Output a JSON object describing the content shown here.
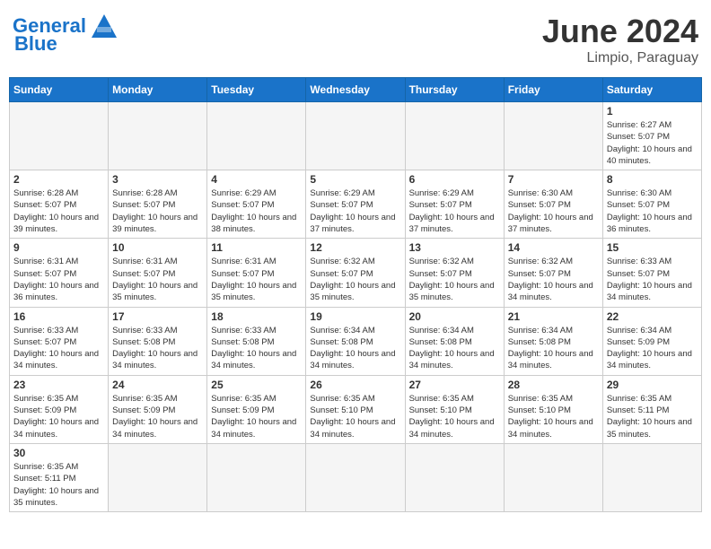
{
  "header": {
    "logo_general": "General",
    "logo_blue": "Blue",
    "title": "June 2024",
    "location": "Limpio, Paraguay"
  },
  "days_of_week": [
    "Sunday",
    "Monday",
    "Tuesday",
    "Wednesday",
    "Thursday",
    "Friday",
    "Saturday"
  ],
  "weeks": [
    [
      {
        "day": "",
        "info": ""
      },
      {
        "day": "",
        "info": ""
      },
      {
        "day": "",
        "info": ""
      },
      {
        "day": "",
        "info": ""
      },
      {
        "day": "",
        "info": ""
      },
      {
        "day": "",
        "info": ""
      },
      {
        "day": "1",
        "info": "Sunrise: 6:27 AM\nSunset: 5:07 PM\nDaylight: 10 hours and 40 minutes."
      }
    ],
    [
      {
        "day": "2",
        "info": "Sunrise: 6:28 AM\nSunset: 5:07 PM\nDaylight: 10 hours and 39 minutes."
      },
      {
        "day": "3",
        "info": "Sunrise: 6:28 AM\nSunset: 5:07 PM\nDaylight: 10 hours and 39 minutes."
      },
      {
        "day": "4",
        "info": "Sunrise: 6:29 AM\nSunset: 5:07 PM\nDaylight: 10 hours and 38 minutes."
      },
      {
        "day": "5",
        "info": "Sunrise: 6:29 AM\nSunset: 5:07 PM\nDaylight: 10 hours and 37 minutes."
      },
      {
        "day": "6",
        "info": "Sunrise: 6:29 AM\nSunset: 5:07 PM\nDaylight: 10 hours and 37 minutes."
      },
      {
        "day": "7",
        "info": "Sunrise: 6:30 AM\nSunset: 5:07 PM\nDaylight: 10 hours and 37 minutes."
      },
      {
        "day": "8",
        "info": "Sunrise: 6:30 AM\nSunset: 5:07 PM\nDaylight: 10 hours and 36 minutes."
      }
    ],
    [
      {
        "day": "9",
        "info": "Sunrise: 6:31 AM\nSunset: 5:07 PM\nDaylight: 10 hours and 36 minutes."
      },
      {
        "day": "10",
        "info": "Sunrise: 6:31 AM\nSunset: 5:07 PM\nDaylight: 10 hours and 35 minutes."
      },
      {
        "day": "11",
        "info": "Sunrise: 6:31 AM\nSunset: 5:07 PM\nDaylight: 10 hours and 35 minutes."
      },
      {
        "day": "12",
        "info": "Sunrise: 6:32 AM\nSunset: 5:07 PM\nDaylight: 10 hours and 35 minutes."
      },
      {
        "day": "13",
        "info": "Sunrise: 6:32 AM\nSunset: 5:07 PM\nDaylight: 10 hours and 35 minutes."
      },
      {
        "day": "14",
        "info": "Sunrise: 6:32 AM\nSunset: 5:07 PM\nDaylight: 10 hours and 34 minutes."
      },
      {
        "day": "15",
        "info": "Sunrise: 6:33 AM\nSunset: 5:07 PM\nDaylight: 10 hours and 34 minutes."
      }
    ],
    [
      {
        "day": "16",
        "info": "Sunrise: 6:33 AM\nSunset: 5:07 PM\nDaylight: 10 hours and 34 minutes."
      },
      {
        "day": "17",
        "info": "Sunrise: 6:33 AM\nSunset: 5:08 PM\nDaylight: 10 hours and 34 minutes."
      },
      {
        "day": "18",
        "info": "Sunrise: 6:33 AM\nSunset: 5:08 PM\nDaylight: 10 hours and 34 minutes."
      },
      {
        "day": "19",
        "info": "Sunrise: 6:34 AM\nSunset: 5:08 PM\nDaylight: 10 hours and 34 minutes."
      },
      {
        "day": "20",
        "info": "Sunrise: 6:34 AM\nSunset: 5:08 PM\nDaylight: 10 hours and 34 minutes."
      },
      {
        "day": "21",
        "info": "Sunrise: 6:34 AM\nSunset: 5:08 PM\nDaylight: 10 hours and 34 minutes."
      },
      {
        "day": "22",
        "info": "Sunrise: 6:34 AM\nSunset: 5:09 PM\nDaylight: 10 hours and 34 minutes."
      }
    ],
    [
      {
        "day": "23",
        "info": "Sunrise: 6:35 AM\nSunset: 5:09 PM\nDaylight: 10 hours and 34 minutes."
      },
      {
        "day": "24",
        "info": "Sunrise: 6:35 AM\nSunset: 5:09 PM\nDaylight: 10 hours and 34 minutes."
      },
      {
        "day": "25",
        "info": "Sunrise: 6:35 AM\nSunset: 5:09 PM\nDaylight: 10 hours and 34 minutes."
      },
      {
        "day": "26",
        "info": "Sunrise: 6:35 AM\nSunset: 5:10 PM\nDaylight: 10 hours and 34 minutes."
      },
      {
        "day": "27",
        "info": "Sunrise: 6:35 AM\nSunset: 5:10 PM\nDaylight: 10 hours and 34 minutes."
      },
      {
        "day": "28",
        "info": "Sunrise: 6:35 AM\nSunset: 5:10 PM\nDaylight: 10 hours and 34 minutes."
      },
      {
        "day": "29",
        "info": "Sunrise: 6:35 AM\nSunset: 5:11 PM\nDaylight: 10 hours and 35 minutes."
      }
    ],
    [
      {
        "day": "30",
        "info": "Sunrise: 6:35 AM\nSunset: 5:11 PM\nDaylight: 10 hours and 35 minutes."
      },
      {
        "day": "",
        "info": ""
      },
      {
        "day": "",
        "info": ""
      },
      {
        "day": "",
        "info": ""
      },
      {
        "day": "",
        "info": ""
      },
      {
        "day": "",
        "info": ""
      },
      {
        "day": "",
        "info": ""
      }
    ]
  ]
}
